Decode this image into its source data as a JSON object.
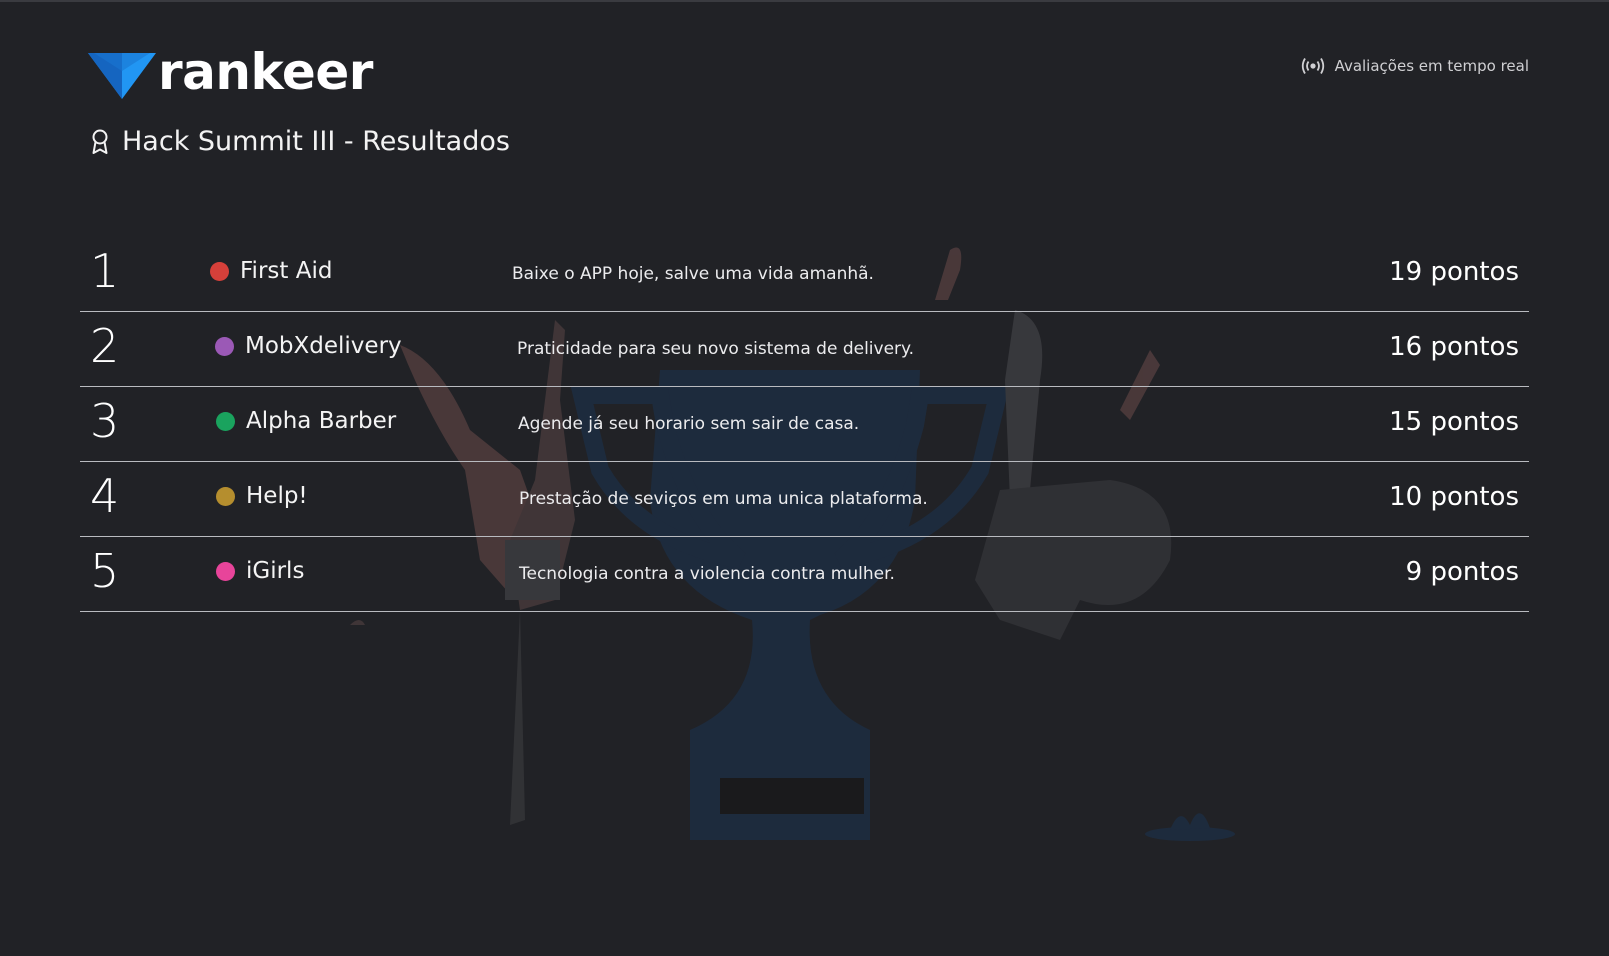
{
  "brand": {
    "name": "rankeer",
    "logo_icon": "triangle-logo-icon",
    "colors": {
      "primary": "#1565c0",
      "secondary": "#2196f3"
    }
  },
  "live_indicator": {
    "icon": "broadcast-icon",
    "label": "Avaliações em tempo real"
  },
  "event": {
    "icon": "award-icon",
    "title": "Hack Summit III - Resultados"
  },
  "ranking": [
    {
      "position": "1",
      "team": "First Aid",
      "color": "#d6403a",
      "tagline": "Baixe o APP hoje, salve uma vida amanhã.",
      "score": "19 pontos"
    },
    {
      "position": "2",
      "team": "MobXdelivery",
      "color": "#9b59b6",
      "tagline": "Praticidade para seu novo sistema de delivery.",
      "score": "16 pontos"
    },
    {
      "position": "3",
      "team": "Alpha Barber",
      "color": "#1aa35e",
      "tagline": "Agende já seu horario sem sair de casa.",
      "score": "15 pontos"
    },
    {
      "position": "4",
      "team": "Help!",
      "color": "#b58e2e",
      "tagline": "Prestação de seviços em uma unica plataforma.",
      "score": "10 pontos"
    },
    {
      "position": "5",
      "team": "iGirls",
      "color": "#e8449a",
      "tagline": "Tecnologia contra a violencia contra mulher.",
      "score": "9 pontos"
    }
  ],
  "background_illustration": "trophy-celebration-illustration"
}
